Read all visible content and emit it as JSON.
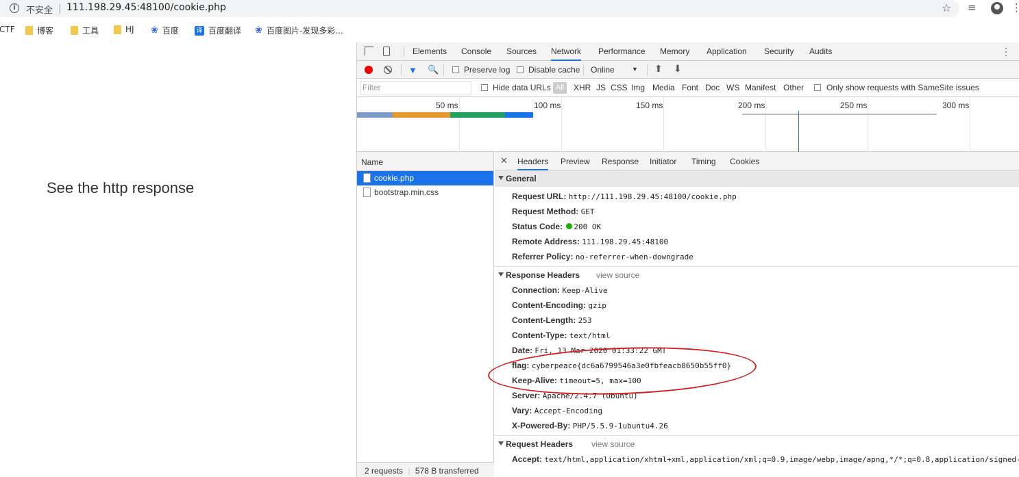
{
  "browser": {
    "security_label": "不安全",
    "url": "111.198.29.45:48100/cookie.php"
  },
  "bookmarks": [
    {
      "label": "CTF",
      "icon": "none"
    },
    {
      "label": "博客",
      "icon": "folder-icon"
    },
    {
      "label": "工具",
      "icon": "folder-icon"
    },
    {
      "label": "HJ",
      "icon": "folder-icon"
    },
    {
      "label": "百度",
      "icon": "baidu-paw-icon"
    },
    {
      "label": "百度翻译",
      "icon": "translate-icon"
    },
    {
      "label": "百度图片-发现多彩...",
      "icon": "baidu-paw-icon"
    }
  ],
  "page": {
    "message": "See the http response"
  },
  "devtools": {
    "tabs": [
      "Elements",
      "Console",
      "Sources",
      "Network",
      "Performance",
      "Memory",
      "Application",
      "Security",
      "Audits"
    ],
    "active_tab": "Network",
    "toolbar": {
      "preserve_log": "Preserve log",
      "disable_cache": "Disable cache",
      "throttle": "Online",
      "throttle_arrow": "▼"
    },
    "filterbar": {
      "placeholder": "Filter",
      "hide_data_urls": "Hide data URLs",
      "all": "All",
      "types": [
        "XHR",
        "JS",
        "CSS",
        "Img",
        "Media",
        "Font",
        "Doc",
        "WS",
        "Manifest",
        "Other"
      ],
      "samesite": "Only show requests with SameSite issues"
    },
    "overview": {
      "ticks": [
        "50 ms",
        "100 ms",
        "150 ms",
        "200 ms",
        "250 ms",
        "300 ms"
      ]
    },
    "requests": {
      "header": "Name",
      "items": [
        "cookie.php",
        "bootstrap.min.css"
      ],
      "selected": "cookie.php",
      "summary": {
        "count": "2 requests",
        "transferred": "578 B transferred"
      }
    },
    "detail": {
      "tabs": [
        "Headers",
        "Preview",
        "Response",
        "Initiator",
        "Timing",
        "Cookies"
      ],
      "active_tab": "Headers",
      "general": {
        "title": "General",
        "rows": [
          {
            "k": "Request URL:",
            "v": "http://111.198.29.45:48100/cookie.php"
          },
          {
            "k": "Request Method:",
            "v": "GET"
          },
          {
            "k": "Status Code:",
            "v": "200 OK"
          },
          {
            "k": "Remote Address:",
            "v": "111.198.29.45:48100"
          },
          {
            "k": "Referrer Policy:",
            "v": "no-referrer-when-downgrade"
          }
        ]
      },
      "response_headers": {
        "title": "Response Headers",
        "view_source": "view source",
        "rows": [
          {
            "k": "Connection:",
            "v": "Keep-Alive"
          },
          {
            "k": "Content-Encoding:",
            "v": "gzip"
          },
          {
            "k": "Content-Length:",
            "v": "253"
          },
          {
            "k": "Content-Type:",
            "v": "text/html"
          },
          {
            "k": "Date:",
            "v": "Fri, 13 Mar 2020 01:33:22 GMT"
          },
          {
            "k": "flag:",
            "v": "cyberpeace{dc6a6799546a3e0fbfeacb8650b55ff0}"
          },
          {
            "k": "Keep-Alive:",
            "v": "timeout=5, max=100"
          },
          {
            "k": "Server:",
            "v": "Apache/2.4.7 (Ubuntu)"
          },
          {
            "k": "Vary:",
            "v": "Accept-Encoding"
          },
          {
            "k": "X-Powered-By:",
            "v": "PHP/5.5.9-1ubuntu4.26"
          }
        ]
      },
      "request_headers": {
        "title": "Request Headers",
        "view_source": "view source",
        "rows": [
          {
            "k": "Accept:",
            "v": "text/html,application/xhtml+xml,application/xml;q=0.9,image/webp,image/apng,*/*;q=0.8,application/signed-"
          }
        ]
      }
    }
  },
  "colors": {
    "accent": "#1a73e8",
    "record": "#e00000",
    "annotation": "#d42020",
    "status_ok": "#1db100"
  }
}
